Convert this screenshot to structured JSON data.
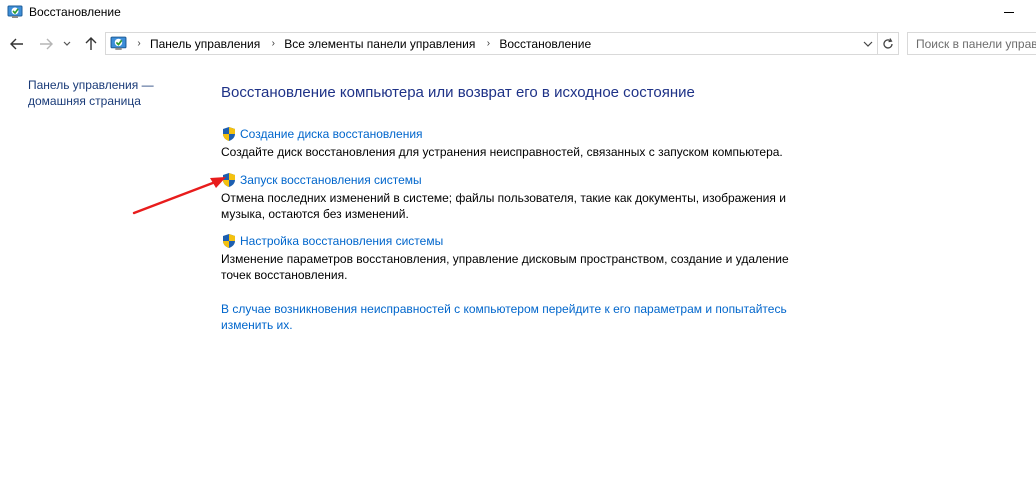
{
  "window": {
    "title": "Восстановление"
  },
  "address_bar": {
    "breadcrumbs": [
      "Панель управления",
      "Все элементы панели управления",
      "Восстановление"
    ]
  },
  "search": {
    "placeholder": "Поиск в панели управления"
  },
  "left_pane": {
    "home_link": "Панель управления — домашняя страница"
  },
  "main": {
    "heading": "Восстановление компьютера или возврат его в исходное состояние",
    "tasks": [
      {
        "label": "Создание диска восстановления",
        "description": "Создайте диск восстановления для устранения неисправностей, связанных с запуском компьютера."
      },
      {
        "label": "Запуск восстановления системы",
        "description": "Отмена последних изменений в системе; файлы пользователя, такие как документы, изображения и музыка, остаются без изменений."
      },
      {
        "label": "Настройка восстановления системы",
        "description": "Изменение параметров восстановления, управление дисковым пространством, создание и удаление точек восстановления."
      }
    ],
    "help_link": "В случае возникновения неисправностей с компьютером перейдите к его параметрам и попытайтесь изменить их."
  },
  "colors": {
    "heading": "#1e3287",
    "link": "#0066cc",
    "annotation_arrow": "#e81c1c"
  }
}
